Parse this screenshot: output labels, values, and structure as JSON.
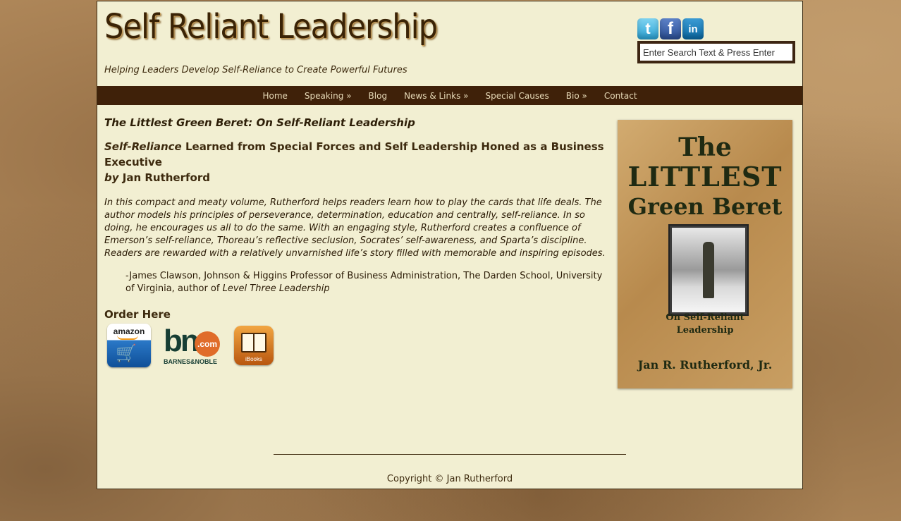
{
  "header": {
    "site_title": "Self Reliant Leadership",
    "tagline": "Helping Leaders Develop Self-Reliance to Create Powerful Futures",
    "social": [
      {
        "name": "twitter-icon",
        "glyph": "t"
      },
      {
        "name": "facebook-icon",
        "glyph": "f"
      },
      {
        "name": "linkedin-icon",
        "glyph": "in"
      }
    ],
    "search_placeholder": "Enter Search Text & Press Enter"
  },
  "nav": {
    "items": [
      "Home",
      "Speaking »",
      "Blog",
      "News & Links »",
      "Special Causes",
      "Bio »",
      "Contact"
    ]
  },
  "article": {
    "title": "The Littlest Green Beret: On Self-Reliant Leadership",
    "subtitle_italic": "Self-Reliance",
    "subtitle_rest": " Learned from Special Forces and Self Leadership Honed as a Business Executive",
    "subtitle_by": "by",
    "subtitle_author": " Jan Rutherford",
    "quote": "In this compact and meaty volume, Rutherford helps readers learn how to play the cards that life deals. The author models his principles of perseverance, determination, education and centrally, self-reliance. In so doing, he encourages us all to do the same. With an engaging style, Rutherford creates a confluence of Emerson’s self-reliance, Thoreau’s reflective seclusion, Socrates’ self-awareness, and Sparta’s discipline. Readers are rewarded with a relatively unvarnished life’s story filled with memorable and inspiring episodes.",
    "attribution": "-James Clawson, Johnson & Higgins Professor of Business Administration, The Darden School, University of Virginia, author of ",
    "attribution_book": "Level Three Leadership",
    "order_heading": "Order Here"
  },
  "stores": {
    "amazon_label": "amazon",
    "bn_letters": "bn",
    "bn_dotcom": ".com",
    "bn_name": "BARNES&NOBLE",
    "ibooks_label": "iBooks"
  },
  "cover": {
    "line1": "The",
    "line2": "LITTLEST",
    "line3": "Green Beret",
    "sub1": "On Self-Reliant",
    "sub2": "Leadership",
    "author": "Jan R. Rutherford, Jr."
  },
  "footer": {
    "copyright": "Copyright © Jan Rutherford"
  },
  "colors": {
    "page_bg": "#f2efd2",
    "nav_bg": "#3f2109",
    "text_brown": "#3d2a0e"
  }
}
